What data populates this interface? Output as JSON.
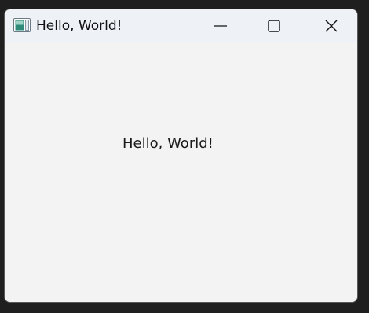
{
  "window": {
    "title": "Hello, World!",
    "app_icon": "app-window-icon",
    "controls": {
      "minimize_icon": "minimize-icon",
      "maximize_icon": "maximize-icon",
      "close_icon": "close-icon"
    }
  },
  "content": {
    "label": "Hello, World!"
  },
  "colors": {
    "titlebar_bg": "#eef2f7",
    "window_bg": "#f3f3f3",
    "desktop_bg": "#1f1f1f",
    "text": "#111111"
  }
}
